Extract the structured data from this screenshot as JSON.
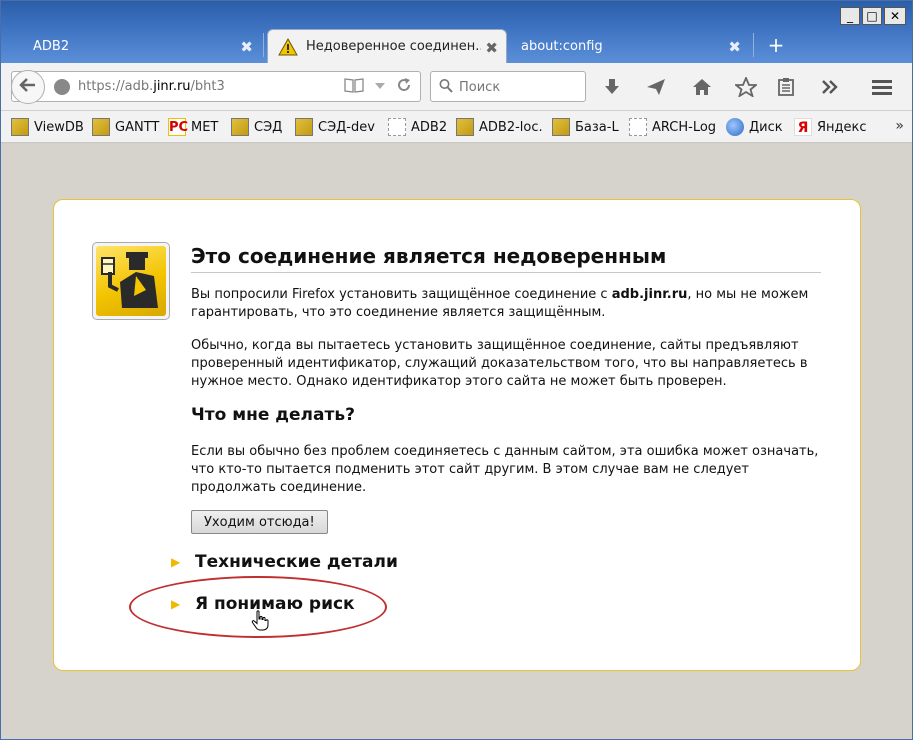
{
  "window": {
    "minimize": "_",
    "maximize": "□",
    "close": "✕"
  },
  "tabs": [
    {
      "label": "ADB2",
      "close": "✖",
      "active": false
    },
    {
      "label": "Недоверенное соединен...",
      "close": "✖",
      "active": true,
      "icon": "warning-icon"
    },
    {
      "label": "about:config",
      "close": "✖",
      "active": false
    }
  ],
  "new_tab": "+",
  "urlbar": {
    "scheme": "https://adb.",
    "host": "jinr.ru",
    "path": "/bht3",
    "icons": [
      "reader-icon",
      "dropdown-icon",
      "reload-icon"
    ]
  },
  "search": {
    "placeholder": "Поиск"
  },
  "toolbar_icons": [
    "download-icon",
    "send-icon",
    "home-icon",
    "bookmark-star-icon",
    "reading-list-icon",
    "overflow-icon",
    "menu-icon"
  ],
  "bookmarks": [
    {
      "label": "ViewDB",
      "icon": "agent"
    },
    {
      "label": "GANTT",
      "icon": "agent"
    },
    {
      "label": "MET",
      "icon": "rs"
    },
    {
      "label": "СЭД",
      "icon": "agent"
    },
    {
      "label": "СЭД-dev",
      "icon": "agent"
    },
    {
      "label": "ADB2",
      "icon": "blank"
    },
    {
      "label": "ADB2-loc.",
      "icon": "agent"
    },
    {
      "label": "База-L",
      "icon": "agent"
    },
    {
      "label": "ARCH-Log",
      "icon": "blank"
    },
    {
      "label": "Диск",
      "icon": "disk"
    },
    {
      "label": "Яндекс",
      "icon": "ya"
    }
  ],
  "bookmarks_more": "»",
  "page": {
    "title": "Это соединение является недоверенным",
    "p1_before": "Вы попросили Firefox установить защищённое соединение с ",
    "p1_host": "adb.jinr.ru",
    "p1_after": ", но мы не можем гарантировать, что это соединение является защищённым.",
    "p2": "Обычно, когда вы пытаетесь установить защищённое соединение, сайты предъявляют проверенный идентификатор, служащий доказательством того, что вы направляетесь в нужное место. Однако идентификатор этого сайта не может быть проверен.",
    "what_to_do": "Что мне делать?",
    "p3": "Если вы обычно без проблем соединяетесь с данным сайтом, эта ошибка может означать, что кто-то пытается подменить этот сайт другим. В этом случае вам не следует продолжать соединение.",
    "leave_button": "Уходим отсюда!",
    "technical_details": "Технические детали",
    "understand_risk": "Я понимаю риск",
    "triangle": "▶"
  },
  "colors": {
    "accent_yellow": "#f0b800",
    "annotation_red": "#c03030",
    "tab_blue": "#3c71c0"
  }
}
